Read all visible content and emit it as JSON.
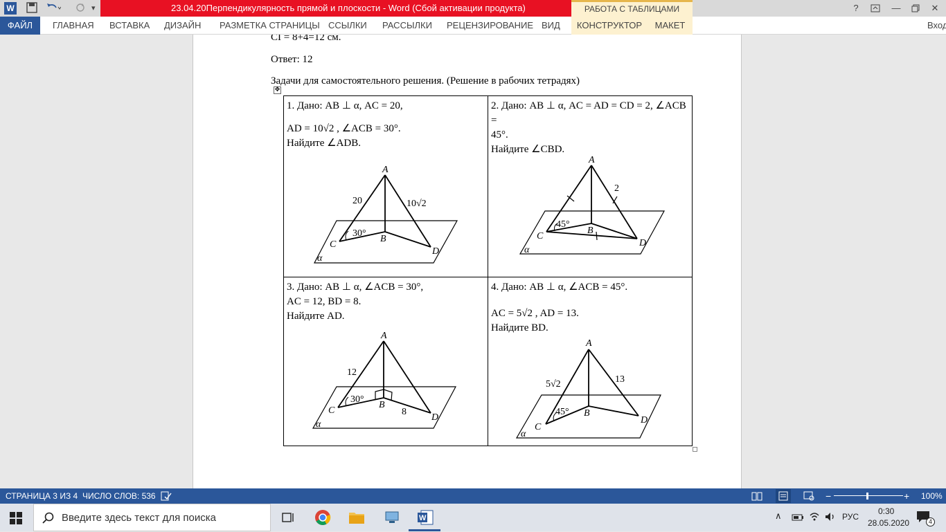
{
  "window": {
    "title": "23.04.20Перпендикулярность прямой и плоскости -  Word (Сбой активации продукта)",
    "context_group": "РАБОТА С ТАБЛИЦАМИ",
    "word_logo": "W"
  },
  "ribbon": {
    "tabs": [
      "ФАЙЛ",
      "ГЛАВНАЯ",
      "ВСТАВКА",
      "ДИЗАЙН",
      "РАЗМЕТКА СТРАНИЦЫ",
      "ССЫЛКИ",
      "РАССЫЛКИ",
      "РЕЦЕНЗИРОВАНИЕ",
      "ВИД",
      "КОНСТРУКТОР",
      "МАКЕТ"
    ],
    "signin": "Вход"
  },
  "document": {
    "prev_line": "CI = 8+4=12 см.",
    "answer": "Ответ: 12",
    "heading": "Задачи для самостоятельного решения. (Решение в рабочих тетрадях)",
    "tasks": [
      {
        "lines": [
          "1. Дано: AB ⊥ α, AC = 20,",
          "AD = 10√2 , ∠ACB = 30°.",
          "Найдите ∠ADB."
        ]
      },
      {
        "lines": [
          "2. Дано: AB ⊥ α, AC = AD = CD = 2, ∠ACB =",
          "45°.",
          "Найдите ∠CBD."
        ]
      },
      {
        "lines": [
          "3. Дано: AB ⊥ α, ∠ACB = 30°,",
          "AC = 12, BD = 8.",
          "Найдите AD."
        ]
      },
      {
        "lines": [
          "4. Дано: AB ⊥ α, ∠ACB = 45°.",
          "AC = 5√2 , AD = 13.",
          "Найдите BD."
        ]
      }
    ],
    "figures": {
      "f1": {
        "A": "A",
        "B": "B",
        "C": "C",
        "D": "D",
        "alpha": "α",
        "side1": "20",
        "side2": "10√2",
        "angle": "30°"
      },
      "f2": {
        "A": "A",
        "B": "B",
        "C": "C",
        "D": "D",
        "alpha": "α",
        "side": "2",
        "angle": "45°"
      },
      "f3": {
        "A": "A",
        "B": "B",
        "C": "C",
        "D": "D",
        "alpha": "α",
        "side1": "12",
        "side2": "8",
        "angle": "30°"
      },
      "f4": {
        "A": "A",
        "B": "B",
        "C": "C",
        "D": "D",
        "alpha": "α",
        "side1": "5√2",
        "side2": "13",
        "angle": "45°"
      }
    }
  },
  "status": {
    "page": "СТРАНИЦА 3 ИЗ 4",
    "words": "ЧИСЛО СЛОВ: 536",
    "zoom": "100%"
  },
  "taskbar": {
    "search_placeholder": "Введите здесь текст для поиска",
    "lang": "РУС",
    "time": "0:30",
    "date": "28.05.2020",
    "notifications": "4"
  }
}
